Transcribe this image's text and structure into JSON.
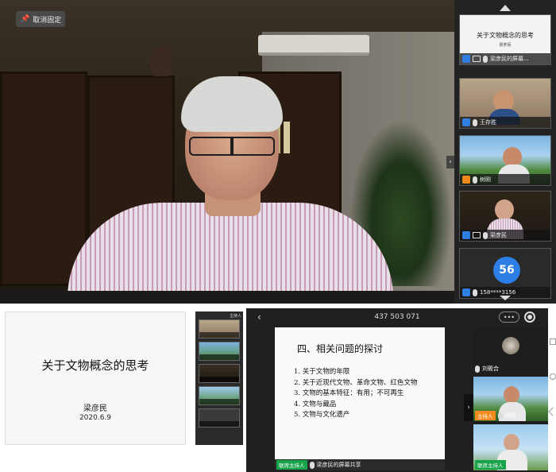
{
  "top": {
    "unpin_label": "取消固定",
    "side_toggle": "›",
    "participants": [
      {
        "name": "梁彦民的屏幕...",
        "slide_text": "关于文物概念的思考",
        "slide_sub": "梁彦民"
      },
      {
        "name": "王存胜"
      },
      {
        "name": "树刚"
      },
      {
        "name": "梁彦民"
      },
      {
        "name": "158****3156",
        "avatar": "56"
      }
    ]
  },
  "bottom_left": {
    "slide_title": "关于文物概念的思考",
    "author": "梁彦民",
    "date": "2020.6.9",
    "strip_label": "主持人"
  },
  "bottom_right": {
    "back": "‹",
    "meeting_id": "437 503 071",
    "more": "•••",
    "slide_title": "四、相关问题的探讨",
    "items": [
      "1. 关于文物的年限",
      "2. 关于近现代文物、革命文物、红色文物",
      "3. 文物的基本特征：有用；不可再生",
      "4.  文物与藏品",
      "5.  文物与文化遗产"
    ],
    "host_badge": "联席主持人",
    "screen_share_label": "梁彦民的屏幕共享",
    "side_arrow": "›",
    "strip": [
      {
        "name": "刘筱合"
      },
      {
        "name": "树刚",
        "badge": "主持人"
      },
      {
        "name": "",
        "badge": "联席主持人"
      }
    ]
  },
  "colors": {
    "accent_blue": "#2d7ee6",
    "host_green": "#17a34a",
    "host_orange": "#f08a1c"
  }
}
